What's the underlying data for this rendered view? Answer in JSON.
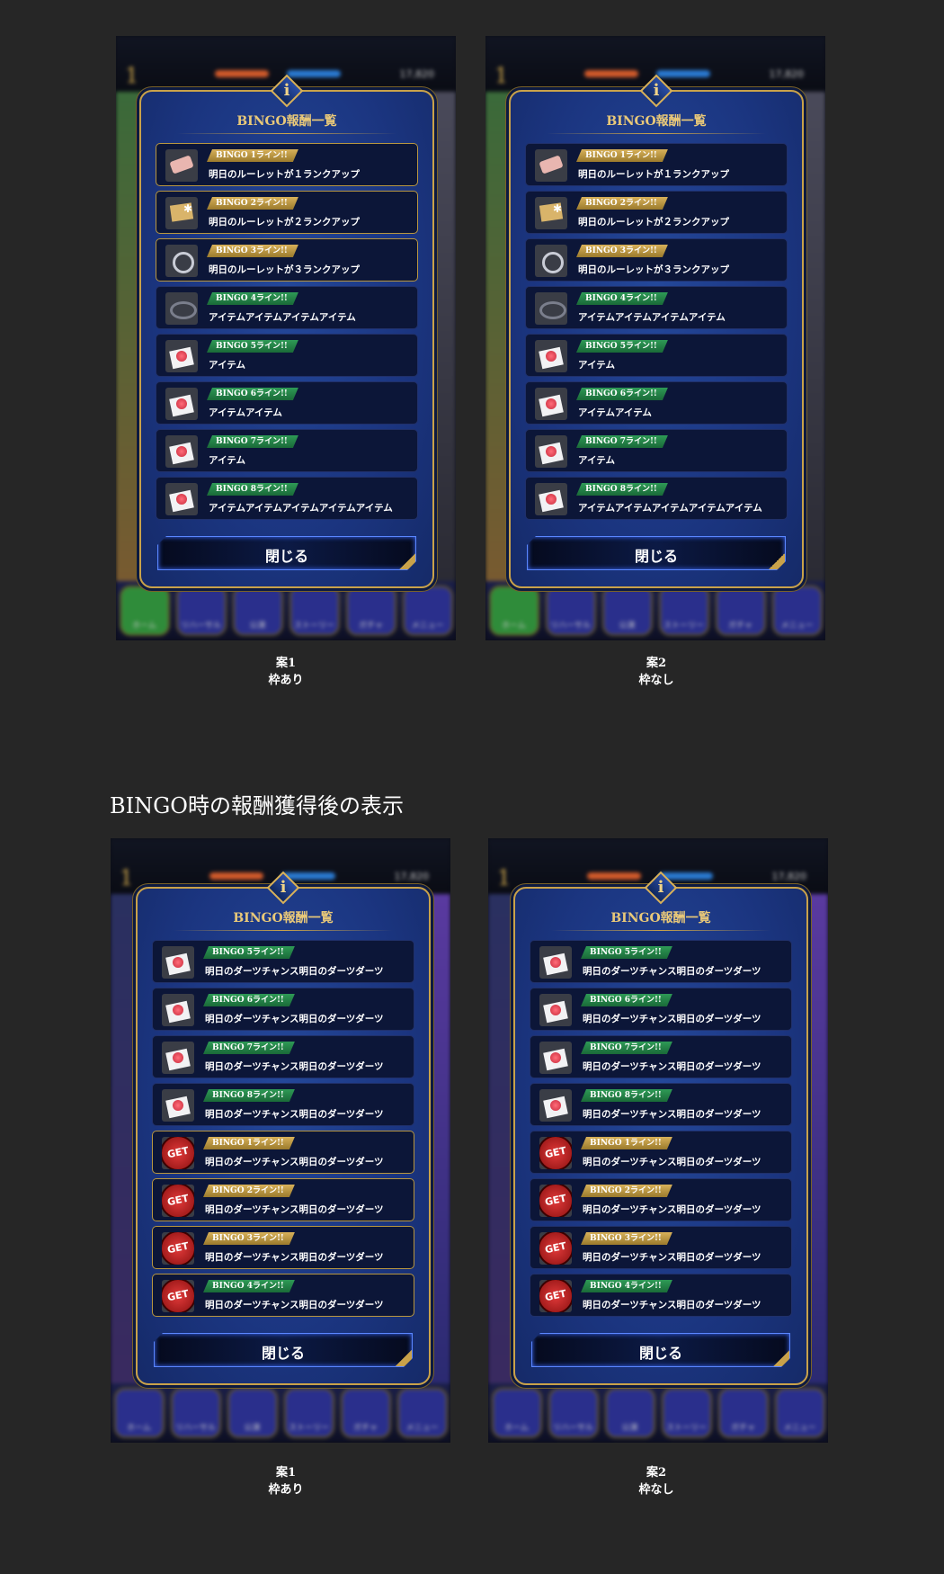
{
  "panel_title": "BINGO報酬一覧",
  "close_label": "閉じる",
  "info_icon": "i",
  "top_number": "17,820",
  "nav_labels": [
    "ホーム",
    "リハーサル",
    "公演",
    "ストーリー",
    "ガチャ",
    "メニュー"
  ],
  "section2_title": "BINGO時の報酬獲得後の表示",
  "captions": [
    {
      "line1": "案1",
      "line2": "枠あり"
    },
    {
      "line1": "案2",
      "line2": "枠なし"
    },
    {
      "line1": "案1",
      "line2": "枠あり"
    },
    {
      "line1": "案2",
      "line2": "枠なし"
    }
  ],
  "list_before": [
    {
      "badge": "BINGO 1ライン!!",
      "desc": "明日のルーレットが１ランクアップ",
      "badge_color": "gold",
      "icon": "pink-scroll-icon"
    },
    {
      "badge": "BINGO 2ライン!!",
      "desc": "明日のルーレットが２ランクアップ",
      "badge_color": "gold",
      "icon": "gold-ticket-icon"
    },
    {
      "badge": "BINGO 3ライン!!",
      "desc": "明日のルーレットが３ランクアップ",
      "badge_color": "gold",
      "icon": "silver-ring-icon"
    },
    {
      "badge": "BINGO 4ライン!!",
      "desc": "アイテムアイテムアイテムアイテム",
      "badge_color": "green",
      "icon": "dark-ring-icon"
    },
    {
      "badge": "BINGO 5ライン!!",
      "desc": "アイテム",
      "badge_color": "green",
      "icon": "rose-card-icon"
    },
    {
      "badge": "BINGO 6ライン!!",
      "desc": "アイテムアイテム",
      "badge_color": "green",
      "icon": "rose-card-icon"
    },
    {
      "badge": "BINGO 7ライン!!",
      "desc": "アイテム",
      "badge_color": "green",
      "icon": "rose-card-icon"
    },
    {
      "badge": "BINGO 8ライン!!",
      "desc": "アイテムアイテムアイテムアイテムアイテム",
      "badge_color": "green",
      "icon": "rose-card-icon"
    }
  ],
  "list_after": [
    {
      "badge": "BINGO 5ライン!!",
      "desc": "明日のダーツチャンス明日のダーツダーツ",
      "badge_color": "green",
      "icon": "rose-card-icon"
    },
    {
      "badge": "BINGO 6ライン!!",
      "desc": "明日のダーツチャンス明日のダーツダーツ",
      "badge_color": "green",
      "icon": "rose-card-icon"
    },
    {
      "badge": "BINGO 7ライン!!",
      "desc": "明日のダーツチャンス明日のダーツダーツ",
      "badge_color": "green",
      "icon": "rose-card-icon"
    },
    {
      "badge": "BINGO 8ライン!!",
      "desc": "明日のダーツチャンス明日のダーツダーツ",
      "badge_color": "green",
      "icon": "rose-card-icon"
    },
    {
      "badge": "BINGO 1ライン!!",
      "desc": "明日のダーツチャンス明日のダーツダーツ",
      "badge_color": "gold",
      "icon": "get-stamp-icon"
    },
    {
      "badge": "BINGO 2ライン!!",
      "desc": "明日のダーツチャンス明日のダーツダーツ",
      "badge_color": "gold",
      "icon": "get-stamp-icon"
    },
    {
      "badge": "BINGO 3ライン!!",
      "desc": "明日のダーツチャンス明日のダーツダーツ",
      "badge_color": "gold",
      "icon": "get-stamp-icon"
    },
    {
      "badge": "BINGO 4ライン!!",
      "desc": "明日のダーツチャンス明日のダーツダーツ",
      "badge_color": "green",
      "icon": "get-stamp-icon"
    }
  ],
  "get_label": "GET",
  "colors": {
    "accent_gold": "#c9a24a",
    "badge_green": "#2e9a56",
    "panel_blue": "#1b3580",
    "background": "#262626"
  }
}
